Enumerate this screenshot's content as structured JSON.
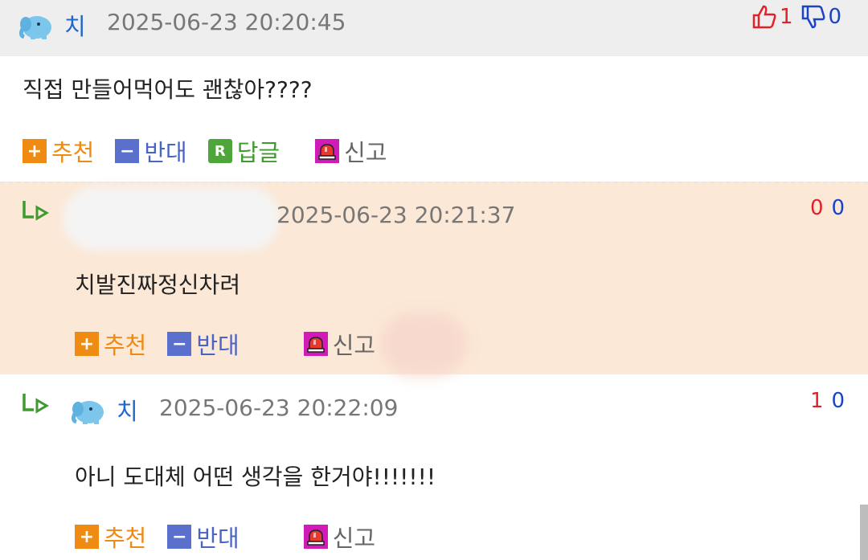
{
  "comments": [
    {
      "nickname": "치",
      "datetime": "2025-06-23 20:20:45",
      "content": "직접 만들어먹어도 괜찮아????",
      "up_count": "1",
      "down_count": "0"
    },
    {
      "datetime": "2025-06-23 20:21:37",
      "content": "치발진짜정신차려",
      "up_count": "0",
      "down_count": "0"
    },
    {
      "nickname": "치",
      "datetime": "2025-06-23 20:22:09",
      "content": "아니 도대체 어떤 생각을 한거야!!!!!!!",
      "up_count": "1",
      "down_count": "0"
    }
  ],
  "actions": {
    "recommend": "추천",
    "oppose": "반대",
    "reply": "답글",
    "report": "신고"
  },
  "icons": {
    "recommend": "plus-icon",
    "oppose": "minus-icon",
    "reply": "reply-r-icon",
    "report": "siren-icon",
    "thumb_up": "thumb-up-icon",
    "thumb_down": "thumb-down-icon",
    "reply_indent": "reply-arrow-icon",
    "avatar": "elephant-avatar-icon"
  },
  "colors": {
    "nickname": "#1e66d2",
    "up": "#e2222a",
    "down": "#1a44c8",
    "reply_background": "#fce8d6",
    "header_background": "#eeeeee"
  }
}
